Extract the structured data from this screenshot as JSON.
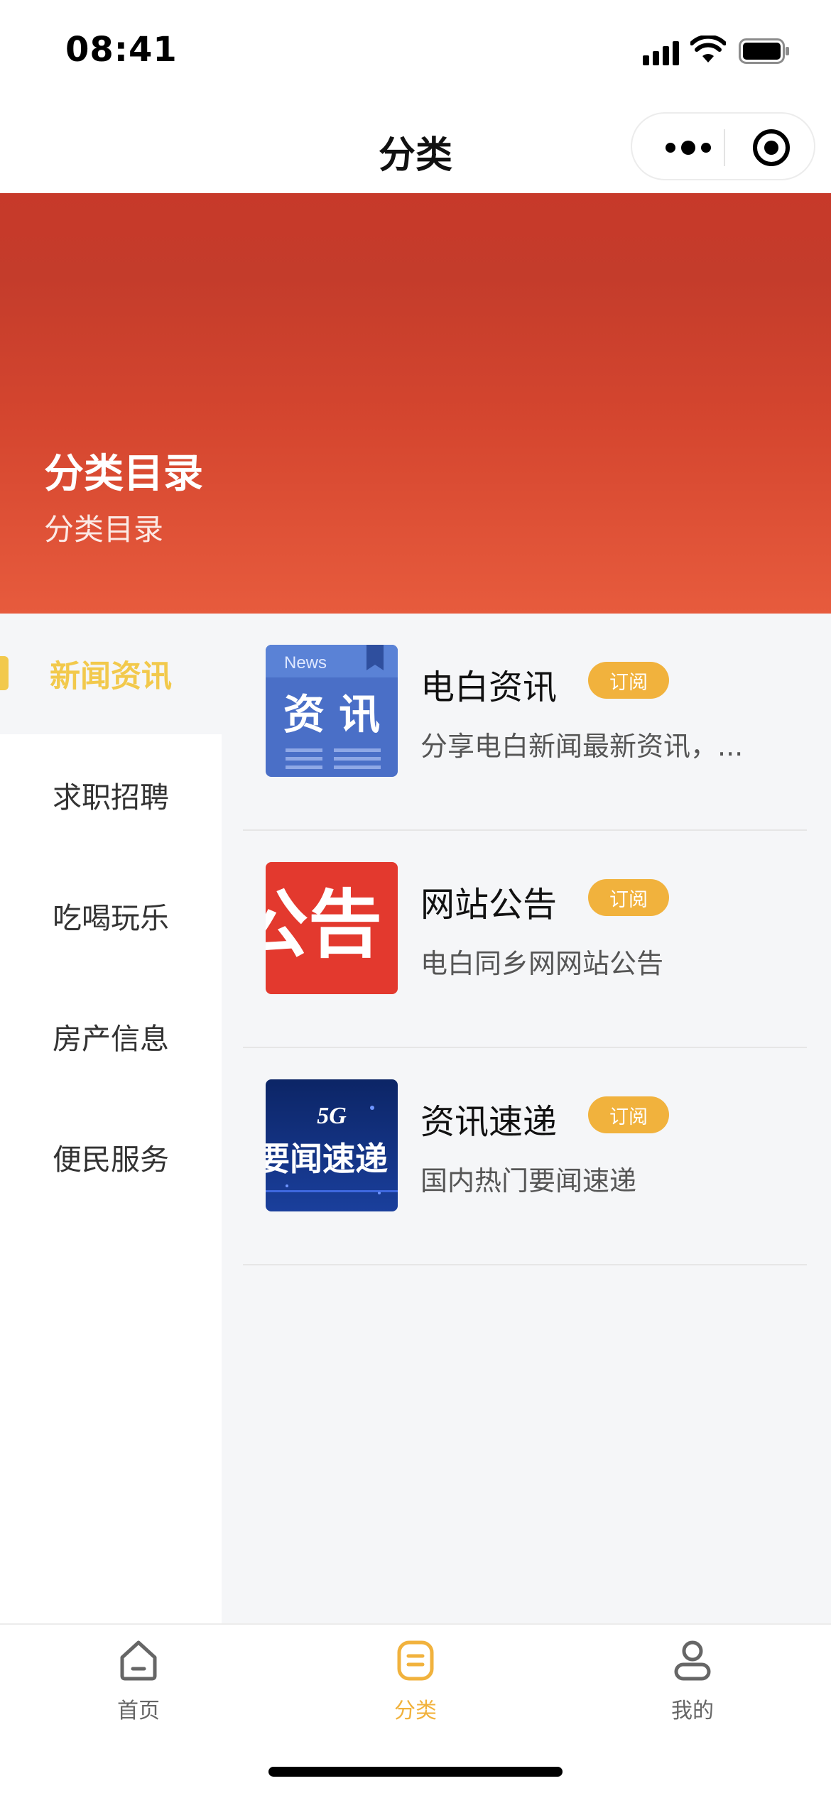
{
  "status_bar": {
    "time": "08:41"
  },
  "nav": {
    "title": "分类"
  },
  "banner": {
    "title": "分类目录",
    "subtitle": "分类目录"
  },
  "sidebar": {
    "items": [
      {
        "label": "新闻资讯",
        "active": true
      },
      {
        "label": "求职招聘",
        "active": false
      },
      {
        "label": "吃喝玩乐",
        "active": false
      },
      {
        "label": "房产信息",
        "active": false
      },
      {
        "label": "便民服务",
        "active": false
      }
    ]
  },
  "list": {
    "items": [
      {
        "title": "电白资讯",
        "tag": "订阅",
        "description": "分享电白新闻最新资讯，...",
        "thumb": {
          "top_text": "News",
          "main_text": "资 讯"
        }
      },
      {
        "title": "网站公告",
        "tag": "订阅",
        "description": "电白同乡网网站公告",
        "thumb": {
          "main_text": "公告"
        }
      },
      {
        "title": "资讯速递",
        "tag": "订阅",
        "description": "国内热门要闻速递",
        "thumb": {
          "top_text": "5G",
          "main_text": "要闻速递"
        }
      }
    ]
  },
  "tabbar": {
    "tabs": [
      {
        "label": "首页",
        "icon": "home-icon",
        "active": false
      },
      {
        "label": "分类",
        "icon": "category-icon",
        "active": true
      },
      {
        "label": "我的",
        "icon": "user-icon",
        "active": false
      }
    ]
  },
  "colors": {
    "accent": "#f1b23d",
    "sidebar_active": "#f2c94c",
    "banner_top": "#c7392a",
    "banner_bottom": "#e75b3d"
  }
}
